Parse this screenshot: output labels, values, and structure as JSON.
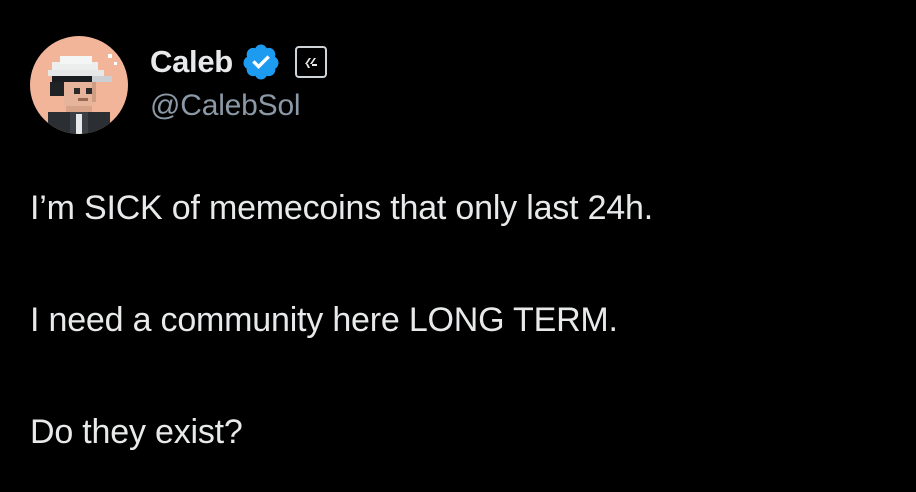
{
  "user": {
    "display_name": "Caleb",
    "handle": "@CalebSol",
    "avatar_icon": "pixel-art-avatar-icon",
    "verified_icon": "verified-badge-icon",
    "affiliate_icon": "affiliate-logo-icon",
    "verified_color": "#1d9bf0"
  },
  "tweet": {
    "paragraphs": [
      "I’m SICK of memecoins that only last 24h.",
      "I need a community here LONG TERM.",
      "Do they exist?"
    ]
  },
  "theme": {
    "background": "#000000",
    "text": "#e7e9ea",
    "secondary_text": "#8b98a5"
  }
}
